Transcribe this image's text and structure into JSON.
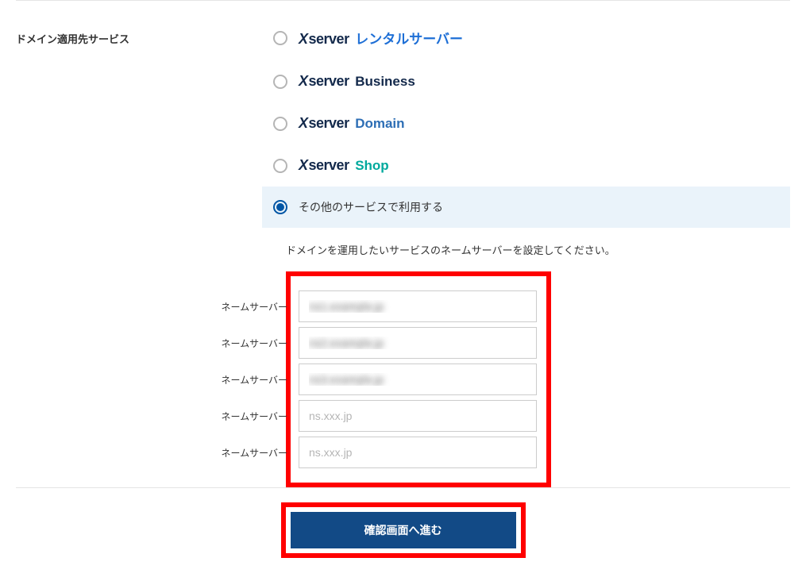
{
  "section_label": "ドメイン適用先サービス",
  "options": {
    "rental": {
      "brand": "Xserver",
      "suffix": "レンタルサーバー"
    },
    "business": {
      "brand": "Xserver",
      "suffix": "Business"
    },
    "domain": {
      "brand": "Xserver",
      "suffix": "Domain"
    },
    "shop": {
      "brand": "Xserver",
      "suffix": "Shop"
    },
    "other": {
      "label": "その他のサービスで利用する"
    }
  },
  "nameserver": {
    "instruction": "ドメインを運用したいサービスのネームサーバーを設定してください。",
    "label": "ネームサーバー",
    "placeholder": "ns.xxx.jp",
    "values": [
      "ns1.example.jp",
      "ns2.example.jp",
      "ns3.example.jp",
      "",
      ""
    ]
  },
  "submit_label": "確認画面へ進む"
}
